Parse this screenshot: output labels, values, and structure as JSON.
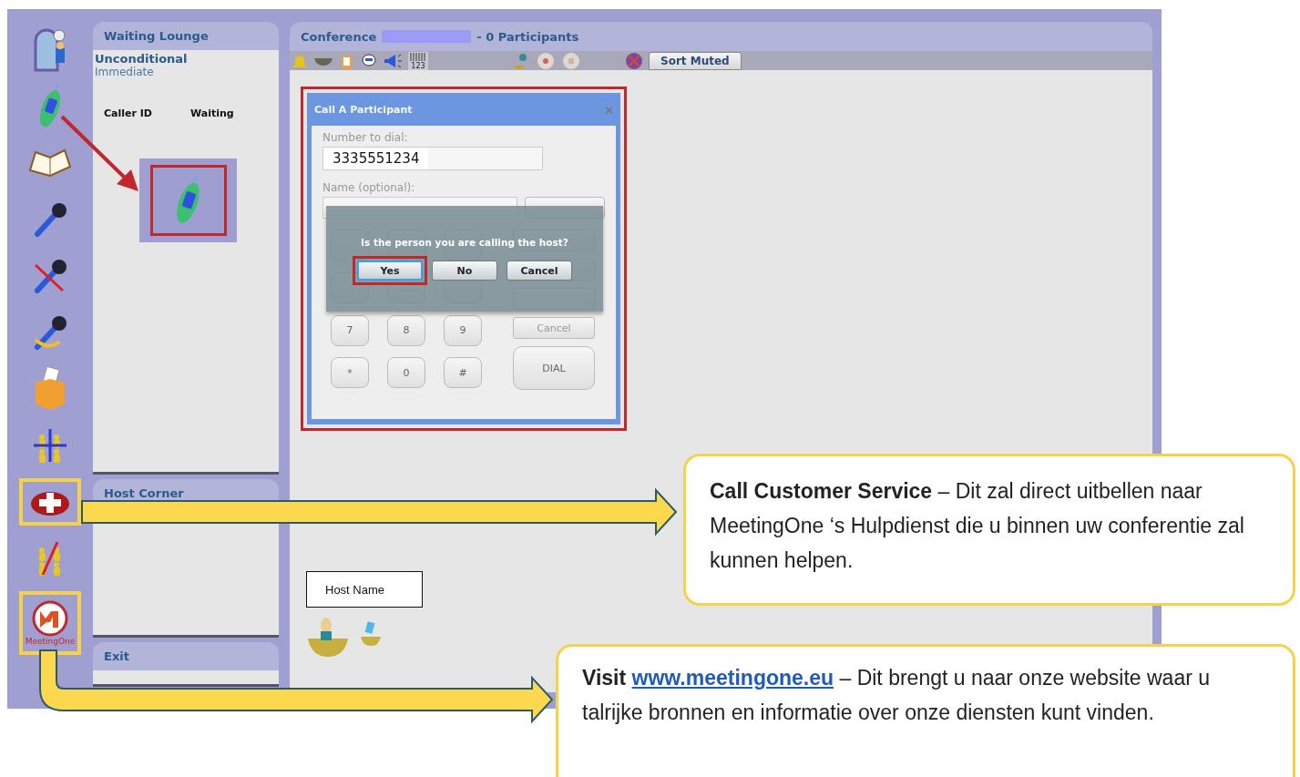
{
  "sidebar": {
    "items": [
      {
        "kind": "lounge",
        "highlighted": false
      },
      {
        "kind": "phone",
        "highlighted": false
      },
      {
        "kind": "book",
        "highlighted": false
      },
      {
        "kind": "mic",
        "highlighted": false
      },
      {
        "kind": "mic-muted",
        "highlighted": false
      },
      {
        "kind": "mic-loop",
        "highlighted": false
      },
      {
        "kind": "ballot",
        "highlighted": false
      },
      {
        "kind": "groups",
        "highlighted": false
      },
      {
        "kind": "help",
        "highlighted": true
      },
      {
        "kind": "groups-off",
        "highlighted": false
      },
      {
        "kind": "logo",
        "label": "MeetingOne",
        "highlighted": true
      }
    ]
  },
  "waiting_lounge": {
    "title": "Waiting Lounge",
    "mode": "Unconditional",
    "mode_detail": "Immediate",
    "columns": [
      "Caller ID",
      "Waiting"
    ]
  },
  "host_corner": {
    "title": "Host Corner"
  },
  "exit": {
    "title": "Exit"
  },
  "conference": {
    "title": "Conference",
    "participants": "- 0 Participants",
    "counter_label": "123",
    "sort_button": "Sort Muted",
    "host_label": "Host Name"
  },
  "dialog": {
    "title": "Call A Participant",
    "close": "×",
    "number_label": "Number to dial:",
    "number_value": "3335551234",
    "name_label": "Name (optional):",
    "cancel_button": "Cancel",
    "bottom_keys": [
      "7",
      "8",
      "9",
      "*",
      "0",
      "#"
    ],
    "dial_button": "DIAL"
  },
  "confirm": {
    "question": "Is the person you are calling the host?",
    "buttons": [
      {
        "label": "Yes",
        "focused": true
      },
      {
        "label": "No",
        "focused": false
      },
      {
        "label": "Cancel",
        "focused": false
      }
    ]
  },
  "callouts": [
    {
      "text": "**Call Customer Service** – Dit zal direct uitbellen naar MeetingOne ‘s Hulpdienst die u binnen uw conferentie zal kunnen helpen."
    },
    {
      "text": "**Visit**",
      "link": "www.meetingone.eu",
      "after": "– Dit brengt u naar onze website waar u talrijke bronnen en informatie over onze diensten kunt vinden."
    }
  ]
}
